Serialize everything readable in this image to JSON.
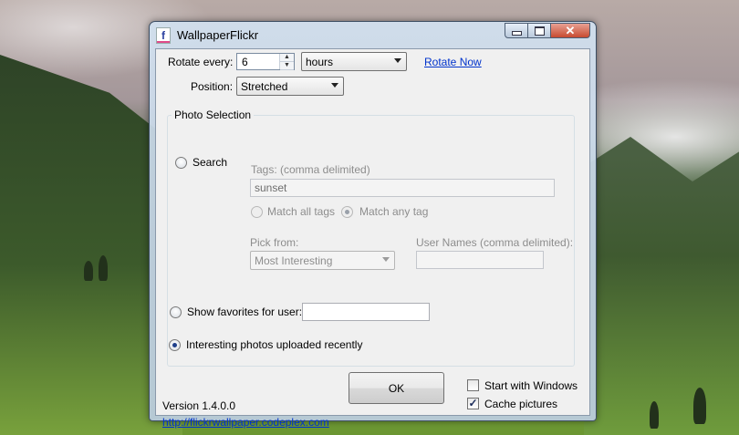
{
  "window": {
    "title": "WallpaperFlickr",
    "icon_letter": "f",
    "minimize_icon": "minimize-icon",
    "maximize_icon": "maximize-icon",
    "close_icon": "close-icon",
    "close_glyph": "✕"
  },
  "rotate": {
    "label": "Rotate every:",
    "value": "6",
    "unit": "hours",
    "rotate_now": "Rotate Now"
  },
  "position": {
    "label": "Position:",
    "value": "Stretched"
  },
  "photo_selection": {
    "title": "Photo Selection",
    "search_label": "Search",
    "tags_label": "Tags:  (comma delimited)",
    "tags_value": "sunset",
    "match_all": "Match all tags",
    "match_any": "Match any tag",
    "pick_from_label": "Pick from:",
    "pick_from_value": "Most Interesting",
    "user_names_label": "User Names (comma delimited):",
    "user_names_value": "",
    "favorites_label": "Show favorites for user:",
    "favorites_value": "",
    "interesting_label": "Interesting photos uploaded recently"
  },
  "options": {
    "start_with_windows": "Start with Windows",
    "start_with_windows_checked": false,
    "cache_pictures": "Cache pictures",
    "cache_pictures_checked": true
  },
  "footer": {
    "version": "Version 1.4.0.0",
    "url": "http://flickrwallpaper.codeplex.com",
    "ok": "OK"
  }
}
